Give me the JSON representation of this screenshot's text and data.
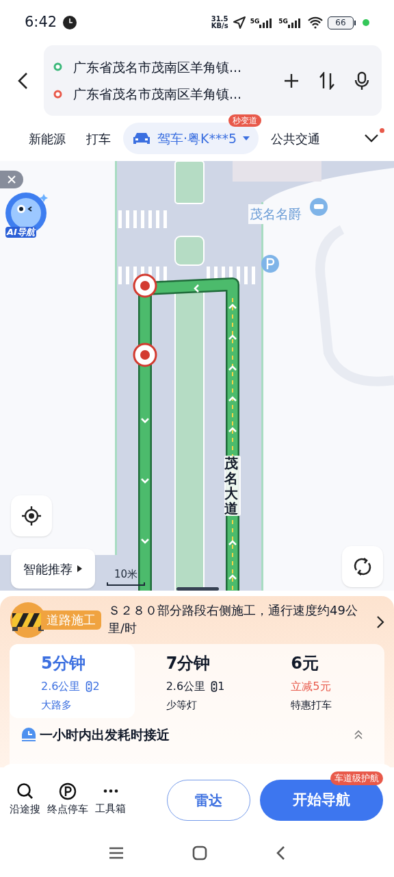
{
  "status_bar": {
    "time": "6:42",
    "speed_value": "31.5",
    "speed_unit": "KB/s",
    "network_1": "5G",
    "network_2": "5G",
    "battery": "66"
  },
  "route": {
    "origin": "广东省茂名市茂南区羊角镇...",
    "destination": "广东省茂名市茂南区羊角镇..."
  },
  "modes": [
    {
      "label": "新能源",
      "selected": false
    },
    {
      "label": "打车",
      "selected": false
    },
    {
      "label": "驾车·粤K***5",
      "selected": true,
      "badge": "秒变道"
    },
    {
      "label": "公共交通",
      "selected": false
    }
  ],
  "map": {
    "ai_button": "AI导航",
    "place_label": "茂名名爵",
    "road_label": "茂名大道",
    "scale": "10米",
    "smart_button": "智能推荐"
  },
  "alert": {
    "tag": "道路施工",
    "text": "Ｓ２８０部分路段右侧施工，通行速度约49公里/时"
  },
  "plans": [
    {
      "kind": "route",
      "title": "5分钟",
      "distance": "2.6公里",
      "lights": "2",
      "note": "大路多",
      "selected": true
    },
    {
      "kind": "route",
      "title": "7分钟",
      "distance": "2.6公里",
      "lights": "1",
      "note": "少等灯",
      "selected": false
    },
    {
      "kind": "taxi",
      "title": "6元",
      "discount": "立减5元",
      "note": "特惠打车",
      "selected": false
    }
  ],
  "departure_tip": "一小时内出发耗时接近",
  "tools": [
    {
      "kind": "search",
      "label": "沿途搜"
    },
    {
      "kind": "parking",
      "label": "终点停车"
    },
    {
      "kind": "more",
      "label": "工具箱"
    }
  ],
  "radar_button": "雷达",
  "start_button": "开始导航",
  "start_badge": "车道级护航"
}
